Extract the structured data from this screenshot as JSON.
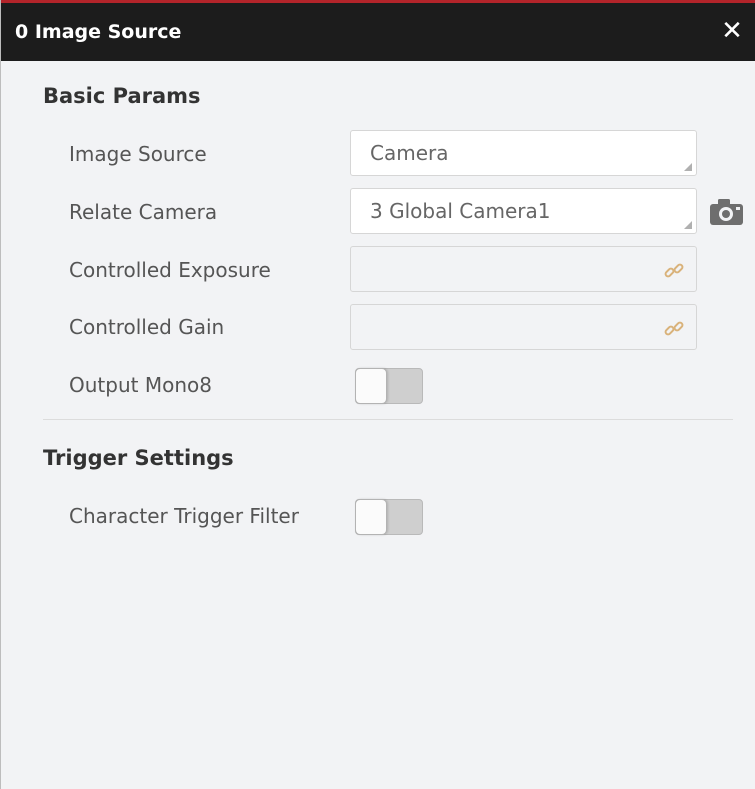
{
  "window": {
    "title": "0 Image Source",
    "close_label": "✕"
  },
  "basic_params": {
    "title": "Basic Params",
    "image_source": {
      "label": "Image Source",
      "value": "Camera"
    },
    "relate_camera": {
      "label": "Relate Camera",
      "value": "3 Global Camera1",
      "icon": "camera-icon"
    },
    "controlled_exposure": {
      "label": "Controlled Exposure",
      "value": "",
      "icon": "link-icon"
    },
    "controlled_gain": {
      "label": "Controlled Gain",
      "value": "",
      "icon": "link-icon"
    },
    "output_mono8": {
      "label": "Output Mono8",
      "state": "off"
    }
  },
  "trigger_settings": {
    "title": "Trigger Settings",
    "character_trigger_filter": {
      "label": "Character Trigger Filter",
      "state": "off"
    }
  },
  "colors": {
    "titlebar": "#1c1c1c",
    "accent_line": "#b3242a",
    "panel": "#f2f3f5"
  }
}
